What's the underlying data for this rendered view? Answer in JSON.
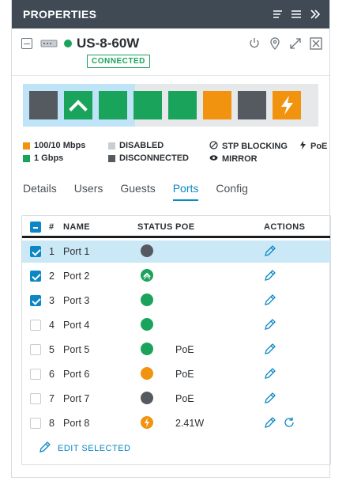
{
  "titlebar": {
    "title": "PROPERTIES",
    "icons": [
      "filter-icon",
      "menu-icon",
      "collapse-panel-icon"
    ]
  },
  "device": {
    "name": "US-8-60W",
    "badge": "CONNECTED",
    "status_color": "#1aa35b",
    "actions": [
      "restart-icon",
      "locate-icon",
      "expand-icon",
      "close-icon"
    ]
  },
  "ports_strip": [
    {
      "port": 1,
      "state": "disconnected",
      "color": "#545a60"
    },
    {
      "port": 2,
      "state": "uplink",
      "color": "#1aa35b"
    },
    {
      "port": 3,
      "state": "1gbps",
      "color": "#1aa35b"
    },
    {
      "port": 4,
      "state": "1gbps",
      "color": "#1aa35b"
    },
    {
      "port": 5,
      "state": "1gbps",
      "color": "#1aa35b"
    },
    {
      "port": 6,
      "state": "100/10",
      "color": "#f2930f"
    },
    {
      "port": 7,
      "state": "disconnected",
      "color": "#545a60"
    },
    {
      "port": 8,
      "state": "poe",
      "color": "#f2930f"
    }
  ],
  "legend": {
    "l100": "100/10 Mbps",
    "l1g": "1 Gbps",
    "disabled": "DISABLED",
    "disconnected": "DISCONNECTED",
    "stp": "STP BLOCKING",
    "mirror": "MIRROR",
    "poe": "PoE",
    "colors": {
      "orange": "#f2930f",
      "green": "#1aa35b",
      "disabled": "#c9cdd1",
      "disconnected": "#545a60"
    }
  },
  "tabs": [
    {
      "label": "Details"
    },
    {
      "label": "Users"
    },
    {
      "label": "Guests"
    },
    {
      "label": "Ports",
      "active": true
    },
    {
      "label": "Config"
    }
  ],
  "table": {
    "headers": {
      "num": "#",
      "name": "NAME",
      "status": "STATUS",
      "poe": "POE",
      "actions": "ACTIONS"
    },
    "rows": [
      {
        "num": "1",
        "name": "Port 1",
        "checked": true,
        "selected": true,
        "status": "disconnected",
        "poe": ""
      },
      {
        "num": "2",
        "name": "Port 2",
        "checked": true,
        "status": "uplink",
        "poe": ""
      },
      {
        "num": "3",
        "name": "Port 3",
        "checked": true,
        "status": "connected",
        "poe": ""
      },
      {
        "num": "4",
        "name": "Port 4",
        "checked": false,
        "status": "connected",
        "poe": ""
      },
      {
        "num": "5",
        "name": "Port 5",
        "checked": false,
        "status": "connected",
        "poe": "PoE"
      },
      {
        "num": "6",
        "name": "Port 6",
        "checked": false,
        "status": "100mbps",
        "poe": "PoE"
      },
      {
        "num": "7",
        "name": "Port 7",
        "checked": false,
        "status": "disconnected",
        "poe": "PoE"
      },
      {
        "num": "8",
        "name": "Port 8",
        "checked": false,
        "status": "poe-active",
        "poe": "2.41W",
        "extra_action": "power-cycle-icon"
      }
    ]
  },
  "edit_selected": "EDIT SELECTED",
  "accent": "#0a87c4"
}
